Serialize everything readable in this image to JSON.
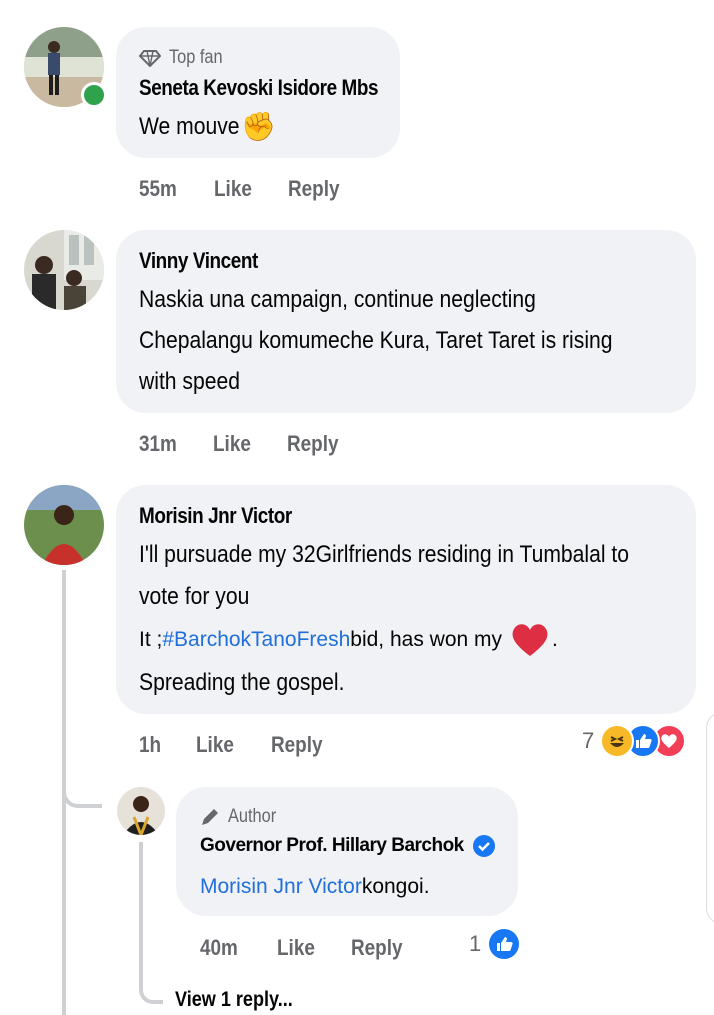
{
  "comments": [
    {
      "badge": "Top fan",
      "author": "Seneta Kevoski Isidore Mbs",
      "text": "We mouve",
      "emoji": "✊",
      "time": "55m",
      "like": "Like",
      "reply": "Reply"
    },
    {
      "author": "Vinny Vincent",
      "lines": [
        "Naskia una campaign, continue neglecting",
        "Chepalangu komumeche Kura, Taret Taret is rising",
        "with speed"
      ],
      "time": "31m",
      "like": "Like",
      "reply": "Reply"
    },
    {
      "author": "Morisin Jnr Victor",
      "line1": "I'll pursuade my 32Girlfriends residing in Tumbalal to",
      "line2": "vote for you",
      "line3_pre": "It ;",
      "hashtag": "#BarchokTanoFresh",
      "line3_post": " bid, has won my",
      "line3_end": ".",
      "line4": " Spreading the gospel.",
      "time": "1h",
      "like": "Like",
      "reply": "Reply",
      "reaction_count": "7"
    }
  ],
  "reply": {
    "badge": "Author",
    "author": "Governor Prof. Hillary Barchok",
    "mention": "Morisin Jnr Victor",
    "text": " kongoi.",
    "time": "40m",
    "like": "Like",
    "reply": "Reply",
    "reaction_count": "1"
  },
  "view_more": "View 1 reply...",
  "colors": {
    "bubble": "#f0f2f5",
    "link": "#216fdb",
    "online": "#31a24c"
  }
}
